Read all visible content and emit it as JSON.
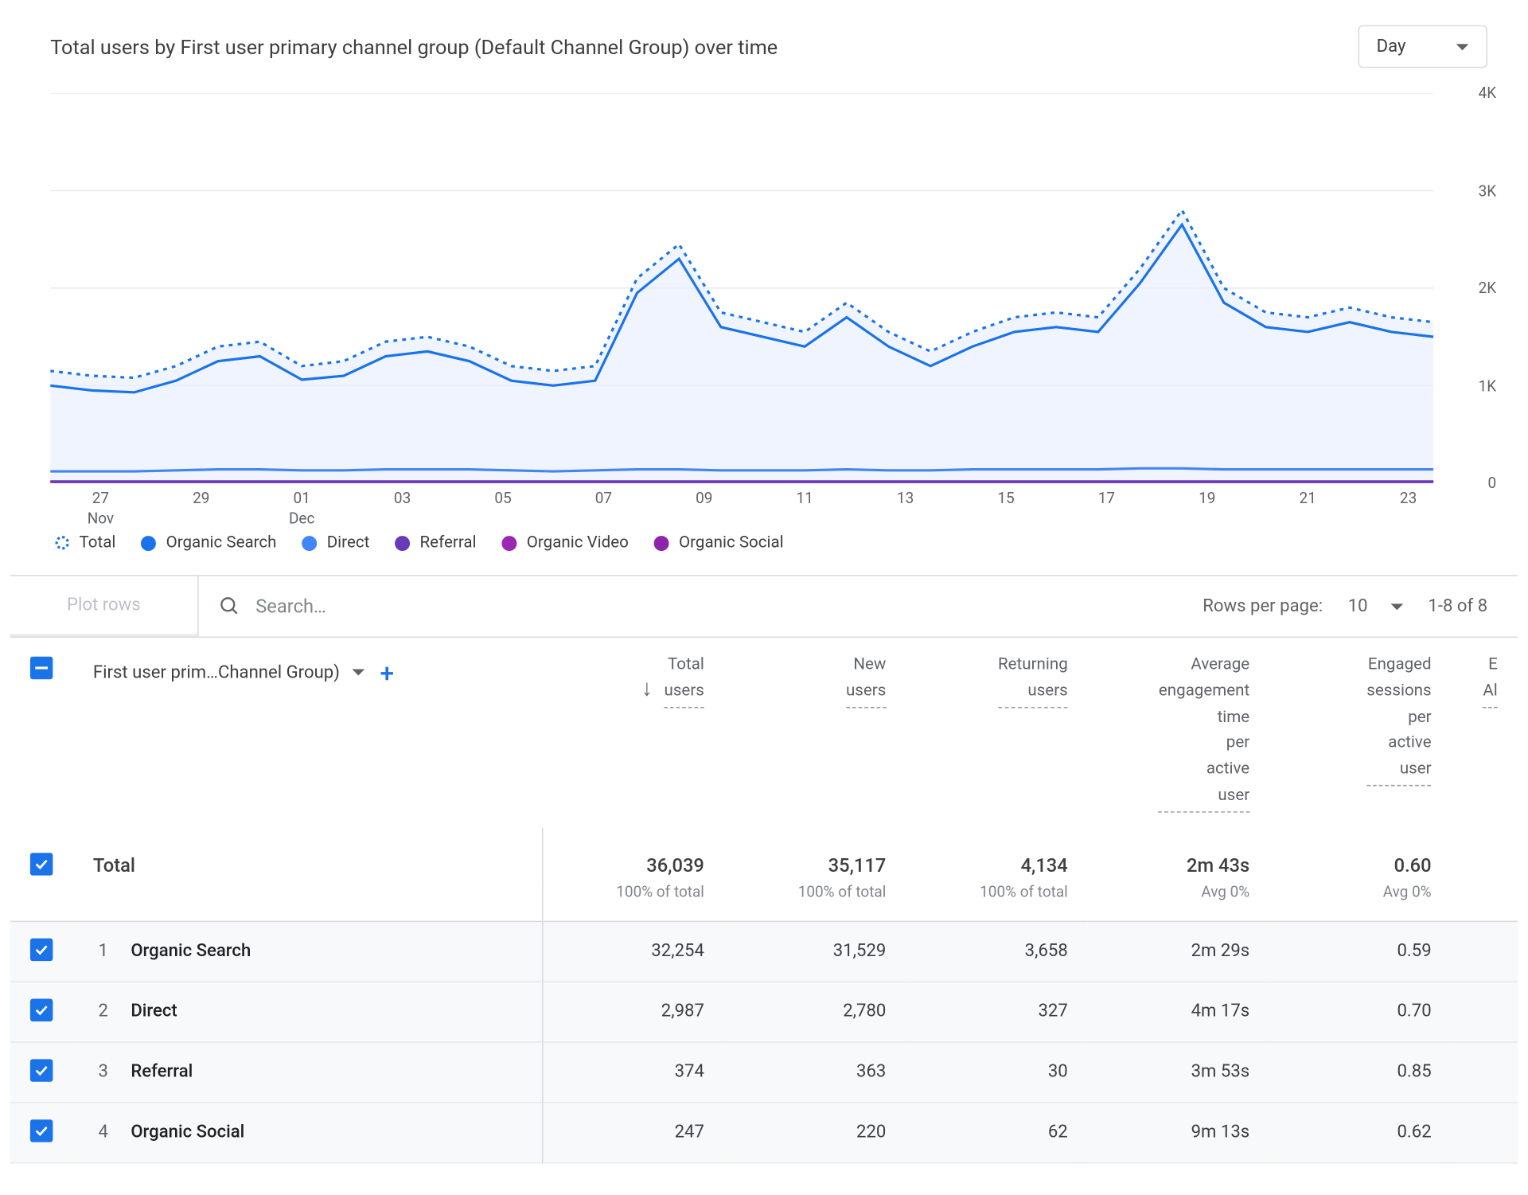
{
  "header": {
    "title": "Total users by First user primary channel group (Default Channel Group) over time",
    "granularity": "Day"
  },
  "chart_data": {
    "type": "line",
    "xlabel": "",
    "ylabel": "",
    "ylim": [
      0,
      4000
    ],
    "y_ticks": [
      0,
      1000,
      2000,
      3000,
      4000
    ],
    "y_tick_labels": [
      "0",
      "1K",
      "2K",
      "3K",
      "4K"
    ],
    "x_ticks": [
      "27\nNov",
      "29",
      "01\nDec",
      "03",
      "05",
      "07",
      "09",
      "11",
      "13",
      "15",
      "17",
      "19",
      "21",
      "23"
    ],
    "series": [
      {
        "name": "Total",
        "style": "dashed",
        "color": "#1a73e8",
        "values": [
          1150,
          1100,
          1080,
          1200,
          1400,
          1450,
          1200,
          1250,
          1450,
          1500,
          1400,
          1200,
          1150,
          1200,
          2100,
          2450,
          1750,
          1650,
          1550,
          1850,
          1550,
          1350,
          1550,
          1700,
          1750,
          1700,
          2200,
          2800,
          2000,
          1750,
          1700,
          1800,
          1700,
          1650
        ]
      },
      {
        "name": "Organic Search",
        "style": "solid",
        "color": "#1a73e8",
        "values": [
          1000,
          950,
          930,
          1050,
          1250,
          1300,
          1060,
          1100,
          1300,
          1350,
          1250,
          1050,
          1000,
          1050,
          1950,
          2300,
          1600,
          1500,
          1400,
          1700,
          1400,
          1200,
          1400,
          1550,
          1600,
          1550,
          2050,
          2650,
          1850,
          1600,
          1550,
          1650,
          1550,
          1500
        ]
      },
      {
        "name": "Direct",
        "style": "solid",
        "color": "#4285f4",
        "values": [
          120,
          120,
          120,
          130,
          140,
          140,
          130,
          130,
          140,
          140,
          140,
          130,
          120,
          130,
          140,
          140,
          130,
          130,
          130,
          140,
          130,
          130,
          140,
          140,
          140,
          140,
          150,
          150,
          140,
          140,
          140,
          140,
          140,
          140
        ]
      },
      {
        "name": "Referral",
        "style": "solid",
        "color": "#673ab7",
        "values": [
          15,
          15,
          15,
          15,
          15,
          15,
          15,
          15,
          15,
          15,
          15,
          15,
          15,
          15,
          15,
          15,
          15,
          15,
          15,
          15,
          15,
          15,
          15,
          15,
          15,
          15,
          15,
          15,
          15,
          15,
          15,
          15,
          15,
          15
        ]
      },
      {
        "name": "Organic Video",
        "style": "solid",
        "color": "#9c27b0",
        "values": [
          10,
          10,
          10,
          10,
          10,
          10,
          10,
          10,
          10,
          10,
          10,
          10,
          10,
          10,
          10,
          10,
          10,
          10,
          10,
          10,
          10,
          10,
          10,
          10,
          10,
          10,
          10,
          10,
          10,
          10,
          10,
          10,
          10,
          10
        ]
      },
      {
        "name": "Organic Social",
        "style": "solid",
        "color": "#8e24aa",
        "values": [
          8,
          8,
          8,
          8,
          8,
          8,
          8,
          8,
          8,
          8,
          8,
          8,
          8,
          8,
          8,
          8,
          8,
          8,
          8,
          8,
          8,
          8,
          8,
          8,
          8,
          8,
          8,
          8,
          8,
          8,
          8,
          8,
          8,
          8
        ]
      }
    ]
  },
  "legend": [
    {
      "label": "Total",
      "color": "#1a73e8",
      "style": "dashed"
    },
    {
      "label": "Organic Search",
      "color": "#1a73e8",
      "style": "solid"
    },
    {
      "label": "Direct",
      "color": "#4285f4",
      "style": "solid"
    },
    {
      "label": "Referral",
      "color": "#673ab7",
      "style": "solid"
    },
    {
      "label": "Organic Video",
      "color": "#9c27b0",
      "style": "solid"
    },
    {
      "label": "Organic Social",
      "color": "#8e24aa",
      "style": "solid"
    }
  ],
  "toolbar": {
    "plot_rows": "Plot rows",
    "search_placeholder": "Search…",
    "rows_per_page_label": "Rows per page:",
    "rows_per_page_value": "10",
    "range": "1-8 of 8"
  },
  "table": {
    "dimension_label": "First user prim…Channel Group)",
    "columns": [
      "Total users",
      "New users",
      "Returning users",
      "Average engagement time per active user",
      "Engaged sessions per active user"
    ],
    "extra_col_hint": "E\nAl",
    "total_label": "Total",
    "totals": [
      "36,039",
      "35,117",
      "4,134",
      "2m 43s",
      "0.60"
    ],
    "totals_sub": [
      "100% of total",
      "100% of total",
      "100% of total",
      "Avg 0%",
      "Avg 0%"
    ],
    "rows": [
      {
        "idx": "1",
        "name": "Organic Search",
        "vals": [
          "32,254",
          "31,529",
          "3,658",
          "2m 29s",
          "0.59"
        ]
      },
      {
        "idx": "2",
        "name": "Direct",
        "vals": [
          "2,987",
          "2,780",
          "327",
          "4m 17s",
          "0.70"
        ]
      },
      {
        "idx": "3",
        "name": "Referral",
        "vals": [
          "374",
          "363",
          "30",
          "3m 53s",
          "0.85"
        ]
      },
      {
        "idx": "4",
        "name": "Organic Social",
        "vals": [
          "247",
          "220",
          "62",
          "9m 13s",
          "0.62"
        ]
      }
    ]
  }
}
